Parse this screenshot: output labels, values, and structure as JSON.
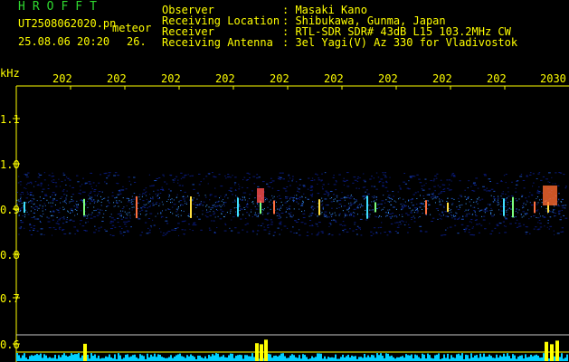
{
  "header": {
    "title": "HROFFT",
    "filename": "UT2508062020.pn",
    "tag": "meteor",
    "datetime": "25.08.06 20:20",
    "count": "26.",
    "labels": [
      "Observer",
      "Receiving Location",
      "Receiver",
      "Receiving Antenna"
    ],
    "values": [
      ": Masaki Kano",
      ": Shibukawa, Gunma, Japan",
      ": RTL-SDR SDR# 43dB L15 103.2MHz CW",
      ": 3el Yagi(V) Az 330 for Vladivostok"
    ]
  },
  "axis": {
    "unit": "kHz",
    "x_ticks": [
      "202",
      "202",
      "202",
      "202",
      "202",
      "202",
      "202",
      "202",
      "202",
      "2030"
    ],
    "y_ticks": [
      "1.1",
      "1.0",
      "0.9",
      "0.8",
      "0.7",
      "0.6"
    ]
  },
  "colors": {
    "axis": "#ffff00",
    "header_title": "#2fd82f",
    "signal_band": "#1030a0",
    "spectrum": "#00d0ff"
  }
}
